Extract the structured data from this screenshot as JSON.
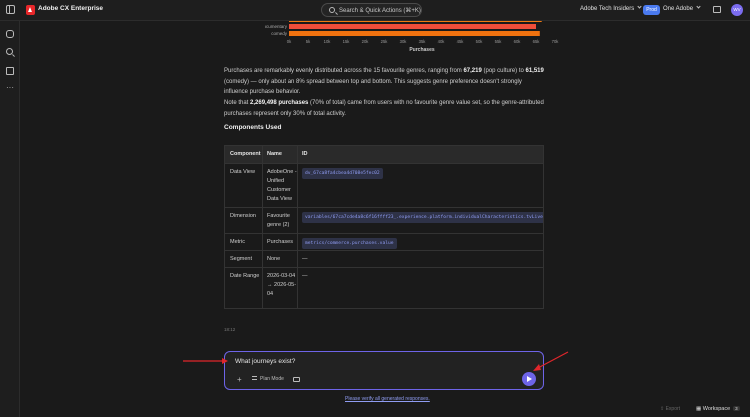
{
  "topbar": {
    "app_title": "Adobe CX Enterprise",
    "search_placeholder": "Search & Quick Actions (⌘+K)",
    "org_name": "Adobe Tech Insiders",
    "env_badge": "Prod",
    "org_switcher": "One Adobe",
    "avatar_initials": "WV"
  },
  "chart_data": {
    "type": "bar",
    "orientation": "horizontal",
    "categories": [
      "documentary",
      "comedy"
    ],
    "values": [
      65000,
      66000
    ],
    "colors": [
      "#ef4e3a",
      "#f0720f"
    ],
    "xlabel": "Purchases",
    "xticks": [
      "0k",
      "5k",
      "10k",
      "15k",
      "20k",
      "25k",
      "30k",
      "35k",
      "40k",
      "45k",
      "50k",
      "55k",
      "60k",
      "65k",
      "70k"
    ],
    "xlim": [
      0,
      70000
    ]
  },
  "paragraphs": {
    "p1_a": "Purchases are remarkably evenly distributed across the 15 favourite genres, ranging from ",
    "p1_b": "67,219",
    "p1_c": " (pop culture) to ",
    "p1_d": "61,519",
    "p1_e": " (comedy) — only about an 8% spread between top and bottom. This suggests genre preference doesn't strongly influence purchase behavior.",
    "p2_a": "Note that ",
    "p2_b": "2,269,498 purchases",
    "p2_c": " (70% of total) came from users with no favourite genre value set, so the genre-attributed purchases represent only 30% of total activity."
  },
  "components": {
    "heading": "Components Used",
    "headers": [
      "Component",
      "Name",
      "ID"
    ],
    "rows": [
      {
        "component": "Data View",
        "name": "AdobeOne - Unified Customer Data View",
        "id": "dv_67ca8fa4cbea4d708e5fec02"
      },
      {
        "component": "Dimension",
        "name": "Favourite genre (2)",
        "id": "variables/67ca7cde4a8c6f16ffff23_.experience.platform.individualCharacteristics.tvLive"
      },
      {
        "component": "Metric",
        "name": "Purchases",
        "id": "metrics/commerce.purchases.value"
      },
      {
        "component": "Segment",
        "name": "None",
        "id": "—"
      },
      {
        "component": "Date Range",
        "name": "2026-03-04 → 2026-05-04",
        "id": "—"
      }
    ]
  },
  "timestamp": "18:12",
  "prompt": {
    "value": "What journeys exist?",
    "plan_mode_label": "Plan Mode"
  },
  "verify_link": "Please verify all generated responses.",
  "footer": {
    "export_label": "Export",
    "workspace_label": "Workspace",
    "workspace_count": "3"
  }
}
